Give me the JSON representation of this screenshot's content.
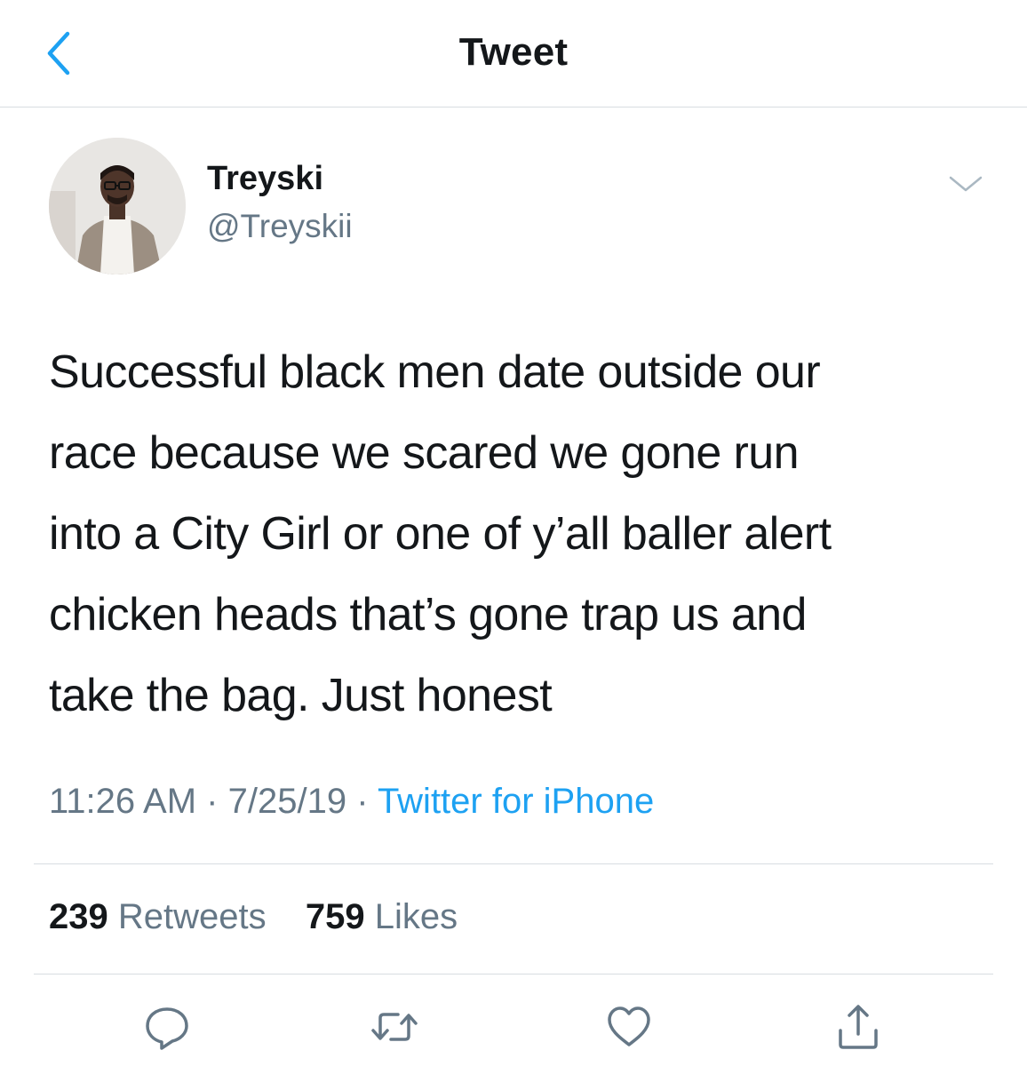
{
  "header": {
    "title": "Tweet",
    "back_icon": "chevron-left-icon"
  },
  "author": {
    "display_name": "Treyski",
    "handle": "@Treyskii"
  },
  "tweet": {
    "text_lines": [
      "Successful black men date outside our",
      "race because we scared we gone run",
      "into a City Girl or one of y’all baller alert",
      "chicken heads that’s gone trap us and",
      "take the bag. Just honest"
    ],
    "time": "11:26 AM",
    "separator": "·",
    "date": "7/25/19",
    "source": "Twitter for iPhone"
  },
  "stats": {
    "retweets_count": "239",
    "retweets_label": "Retweets",
    "likes_count": "759",
    "likes_label": "Likes"
  },
  "actions": [
    "reply-icon",
    "retweet-icon",
    "like-icon",
    "share-icon"
  ],
  "colors": {
    "accent": "#1da1f2",
    "text": "#14171a",
    "muted": "#657786",
    "divider": "#d8dde1"
  }
}
